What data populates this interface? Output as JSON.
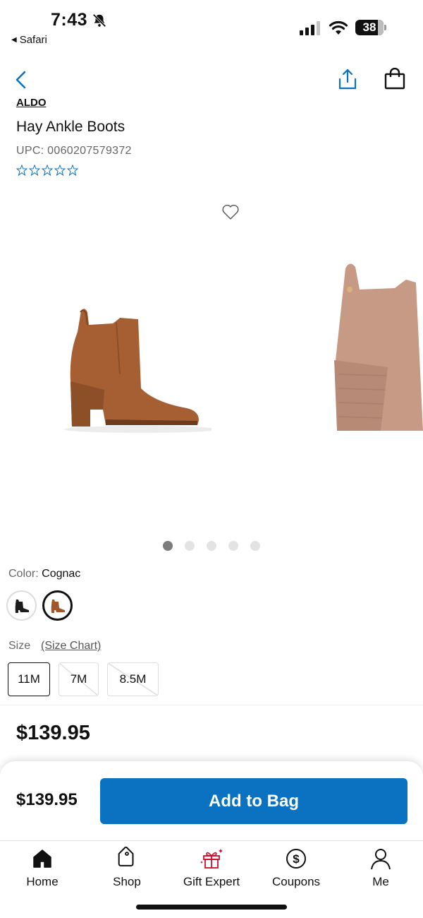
{
  "status_bar": {
    "time": "7:43",
    "back_app": "Safari",
    "battery": "38"
  },
  "product": {
    "brand": "ALDO",
    "title": "Hay Ankle Boots",
    "upc": "UPC: 0060207579372",
    "rating": 0,
    "max_rating": 5
  },
  "carousel": {
    "image_count": 5,
    "active_index": 0
  },
  "color": {
    "label": "Color:",
    "selected": "Cognac",
    "swatches": [
      {
        "name": "black",
        "color": "#1c1c1c",
        "selected": false
      },
      {
        "name": "cognac",
        "color": "#a0572c",
        "selected": true
      }
    ]
  },
  "size": {
    "label": "Size",
    "chart_link": "(Size Chart)",
    "options": [
      {
        "label": "11M",
        "available": true,
        "selected": true
      },
      {
        "label": "7M",
        "available": false,
        "selected": false
      },
      {
        "label": "8.5M",
        "available": false,
        "selected": false
      }
    ]
  },
  "price": "$139.95",
  "buy_bar": {
    "price": "$139.95",
    "button_label": "Add to Bag",
    "button_color": "#0a72c0"
  },
  "tabbar": {
    "items": [
      {
        "label": "Home",
        "icon": "home-icon"
      },
      {
        "label": "Shop",
        "icon": "tag-icon"
      },
      {
        "label": "Gift Expert",
        "icon": "gift-icon"
      },
      {
        "label": "Coupons",
        "icon": "dollar-coin-icon"
      },
      {
        "label": "Me",
        "icon": "person-icon"
      }
    ]
  },
  "colors": {
    "accent_blue": "#0a72c0",
    "gift_red": "#c8102e"
  }
}
